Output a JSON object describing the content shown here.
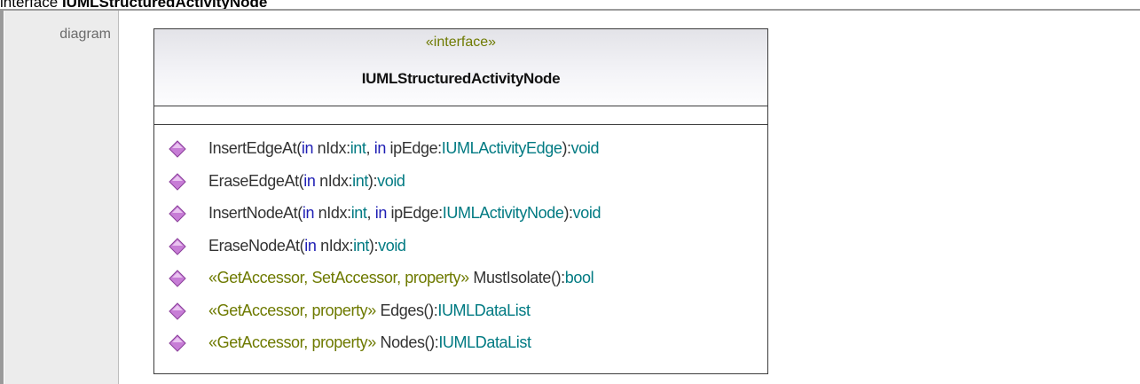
{
  "heading": {
    "prefix": "interface ",
    "name": "IUMLStructuredActivityNode"
  },
  "label": "diagram",
  "class_box": {
    "stereotype": "«interface»",
    "name": "IUMLStructuredActivityNode"
  },
  "icon_color": "#c77dd6",
  "operations": [
    {
      "name": "InsertEdgeAt(",
      "kw1": "in",
      "p1": " nIdx:",
      "t1": "int",
      "sep": ", ",
      "kw2": "in",
      "p2": " ipEdge:",
      "t2": "IUMLActivityEdge",
      "close": "):",
      "ret": "void"
    },
    {
      "name": "EraseEdgeAt(",
      "kw1": "in",
      "p1": " nIdx:",
      "t1": "int",
      "close": "):",
      "ret": "void"
    },
    {
      "name": "InsertNodeAt(",
      "kw1": "in",
      "p1": " nIdx:",
      "t1": "int",
      "sep": ", ",
      "kw2": "in",
      "p2": " ipEdge:",
      "t2": "IUMLActivityNode",
      "close": "):",
      "ret": "void"
    },
    {
      "name": "EraseNodeAt(",
      "kw1": "in",
      "p1": " nIdx:",
      "t1": "int",
      "close": "):",
      "ret": "void"
    },
    {
      "stereo": "«GetAccessor, SetAccessor, property»",
      "name": " MustIsolate():",
      "ret": "bool"
    },
    {
      "stereo": "«GetAccessor, property»",
      "name": " Edges():",
      "ret": "IUMLDataList"
    },
    {
      "stereo": "«GetAccessor, property»",
      "name": " Nodes():",
      "ret": "IUMLDataList"
    }
  ]
}
